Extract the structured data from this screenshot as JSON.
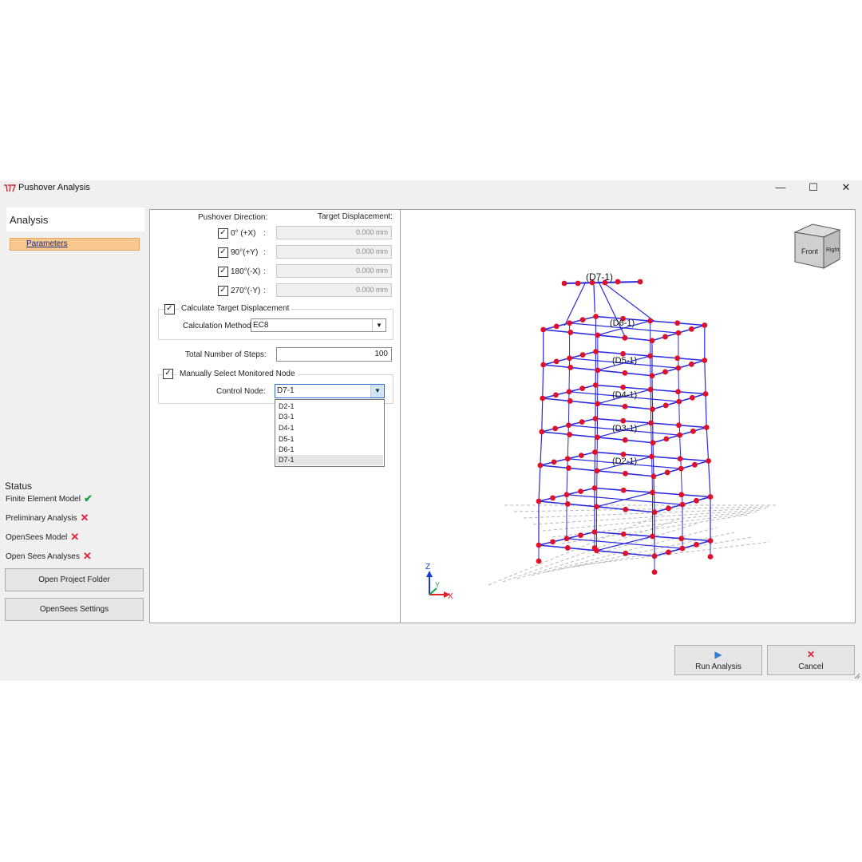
{
  "window": {
    "title": "Pushover Analysis",
    "minimize": "—",
    "maximize": "☐",
    "close": "✕"
  },
  "sidebar": {
    "header": "Analysis",
    "items": [
      {
        "label": "Parameters",
        "selected": true
      }
    ],
    "status_title": "Status",
    "status": [
      {
        "label": "Finite Element Model",
        "ok": true
      },
      {
        "label": "Preliminary Analysis",
        "ok": false
      },
      {
        "label": "OpenSees Model",
        "ok": false
      },
      {
        "label": "Open Sees Analyses",
        "ok": false
      }
    ],
    "buttons": {
      "open_folder": "Open Project Folder",
      "settings": "OpenSees Settings"
    }
  },
  "params": {
    "direction_header": "Pushover Direction:",
    "target_header": "Target Displacement:",
    "directions": [
      {
        "label": "0° (+X)",
        "checked": true,
        "value": "0.000 mm"
      },
      {
        "label": "90°(+Y)",
        "checked": true,
        "value": "0.000 mm"
      },
      {
        "label": "180°(-X)",
        "checked": true,
        "value": "0.000 mm"
      },
      {
        "label": "270°(-Y)",
        "checked": true,
        "value": "0.000 mm"
      }
    ],
    "calc_target": {
      "label": "Calculate Target Displacement",
      "checked": true
    },
    "calc_method": {
      "label": "Calculation Method",
      "value": "EC8"
    },
    "steps": {
      "label": "Total Number of Steps:",
      "value": "100"
    },
    "manual_node": {
      "label": "Manually Select Monitored Node",
      "checked": true
    },
    "control_node": {
      "label": "Control Node:",
      "value": "D7-1",
      "options": [
        "D2-1",
        "D3-1",
        "D4-1",
        "D5-1",
        "D6-1",
        "D7-1"
      ],
      "highlighted": "D7-1"
    }
  },
  "viewport": {
    "node_labels": [
      "(D7-1)",
      "(D6-1)",
      "(D5-1)",
      "(D4-1)",
      "(D3-1)",
      "(D2-1)"
    ],
    "cube_front": "Front",
    "cube_right": "Right",
    "axis_z": "Z",
    "axis_y": "Y",
    "axis_x": "X",
    "colors": {
      "frame": "#2a2ae0",
      "node": "#e0102a",
      "grid": "#b8b8b8"
    }
  },
  "footer": {
    "run": "Run Analysis",
    "cancel": "Cancel",
    "run_icon": "play-icon",
    "cancel_icon": "cross-icon"
  }
}
